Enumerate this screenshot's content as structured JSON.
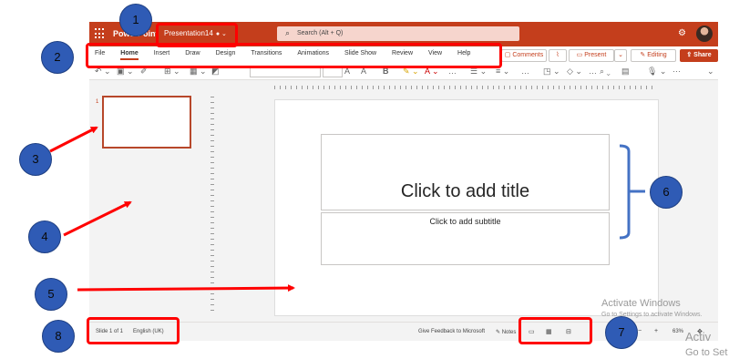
{
  "titlebar": {
    "app_name": "PowerPoint",
    "document_name": "Presentation14",
    "search_placeholder": "Search (Alt + Q)"
  },
  "ribbon": {
    "tabs": [
      "File",
      "Home",
      "Insert",
      "Draw",
      "Design",
      "Transitions",
      "Animations",
      "Slide Show",
      "Review",
      "View",
      "Help"
    ],
    "active_tab": "Home",
    "comments_label": "Comments",
    "present_label": "Present",
    "editing_label": "Editing",
    "share_label": "Share"
  },
  "thumbnails": {
    "slide_number": "1"
  },
  "slide": {
    "title_placeholder": "Click to add title",
    "subtitle_placeholder": "Click to add subtitle"
  },
  "status": {
    "slide_counter": "Slide 1 of 1",
    "language": "English (UK)",
    "feedback": "Give Feedback to Microsoft",
    "notes": "Notes",
    "zoom": "63%"
  },
  "watermark": {
    "line1": "Activate Windows",
    "line2": "Go to Settings to activate Windows.",
    "partial1": "Activ",
    "partial2": "Go to Set"
  },
  "callouts": [
    "1",
    "2",
    "3",
    "4",
    "5",
    "6",
    "7",
    "8"
  ],
  "colors": {
    "brand": "#c43e1c",
    "highlight_box": "#ff0000",
    "callout_fill": "#2f5bb5",
    "bracket": "#4472c4"
  },
  "icons": [
    "app-launcher-icon",
    "info-icon",
    "search-icon",
    "settings-icon",
    "undo-icon",
    "clipboard-icon",
    "new-slide-icon",
    "layout-icon",
    "bold-icon",
    "italic-icon",
    "underline-icon",
    "highlighter-icon",
    "font-color-icon",
    "bullets-icon",
    "align-icon",
    "shapes-icon",
    "find-icon",
    "designer-icon",
    "dictate-icon",
    "more-icon",
    "notes-icon",
    "normal-view-icon",
    "slide-sorter-icon",
    "reading-view-icon",
    "zoom-out-icon",
    "zoom-in-icon",
    "fit-slide-icon"
  ]
}
